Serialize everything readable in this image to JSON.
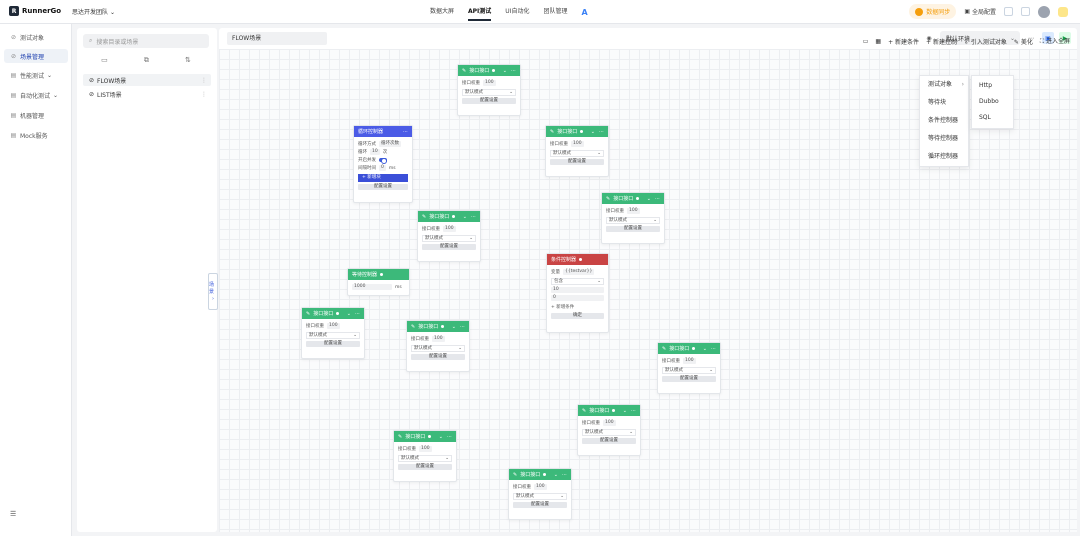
{
  "app": {
    "logo_text": "RunnerGo",
    "team": "思达开发团队"
  },
  "topnav": {
    "items": [
      "数据大屏",
      "API测试",
      "UI自动化",
      "团队管理"
    ],
    "active": 1
  },
  "topright": {
    "sync": "数据同步",
    "global_config": "全局配置"
  },
  "leftnav": {
    "items": [
      {
        "label": "测试对象",
        "icon": "link-icon"
      },
      {
        "label": "场景管理",
        "icon": "scene-icon"
      },
      {
        "label": "性能测试",
        "icon": "perf-icon"
      },
      {
        "label": "自动化测试",
        "icon": "auto-icon"
      },
      {
        "label": "机器管理",
        "icon": "machine-icon"
      },
      {
        "label": "Mock服务",
        "icon": "mock-icon"
      }
    ],
    "active": 1
  },
  "scene_panel": {
    "search_placeholder": "搜索目录或场景",
    "scenes": [
      {
        "label": "FLOW场景"
      },
      {
        "label": "LIST场景"
      }
    ]
  },
  "canvas": {
    "title": "FLOW场景",
    "env": "默认环境",
    "toolbar": {
      "add_condition": "新建条件",
      "add_controller": "新建控制",
      "import_object": "引入测试对象",
      "beautify": "美化",
      "fullscreen": "进入全屏"
    },
    "side_tab": "场景"
  },
  "menu": {
    "items": [
      "测试对象",
      "等待块",
      "条件控制器",
      "等待控制器",
      "循环控制器"
    ],
    "submenu": [
      "Http",
      "Dubbo",
      "SQL"
    ]
  },
  "node_common": {
    "concurrency_label": "接口权重",
    "concurrency_value": "100",
    "mode": "默认模式",
    "config_btn": "配置设置"
  },
  "nodes": [
    {
      "title": "接口接口",
      "type": "green"
    },
    {
      "title": "循环控制器",
      "type": "blue"
    },
    {
      "title": "接口接口",
      "type": "green"
    },
    {
      "title": "接口接口",
      "type": "green"
    },
    {
      "title": "接口接口",
      "type": "green"
    },
    {
      "title": "条件控制器",
      "type": "red"
    },
    {
      "title": "等待控制器",
      "type": "green"
    },
    {
      "title": "接口接口",
      "type": "green"
    },
    {
      "title": "接口接口",
      "type": "green"
    },
    {
      "title": "接口接口",
      "type": "green"
    },
    {
      "title": "接口接口",
      "type": "green"
    },
    {
      "title": "接口接口",
      "type": "green"
    },
    {
      "title": "接口接口",
      "type": "green"
    }
  ],
  "loop_node": {
    "mode_label": "循环方式",
    "mode_value": "循环次数",
    "count_label": "循环",
    "count_value": "10",
    "count_unit": "次",
    "concurrent_label": "开启并发",
    "interval_label": "间隔时间",
    "interval_value": "0",
    "interval_unit": "ms",
    "add_btn": "+ 新增块"
  },
  "cond_node": {
    "var_label": "变量",
    "var_value": "{{testvar}}",
    "op_value": "包含",
    "val_value": "10",
    "val2": "0",
    "add_btn": "+ 新增条件",
    "confirm": "确定"
  },
  "wait_node": {
    "value": "1000",
    "unit": "ms"
  }
}
